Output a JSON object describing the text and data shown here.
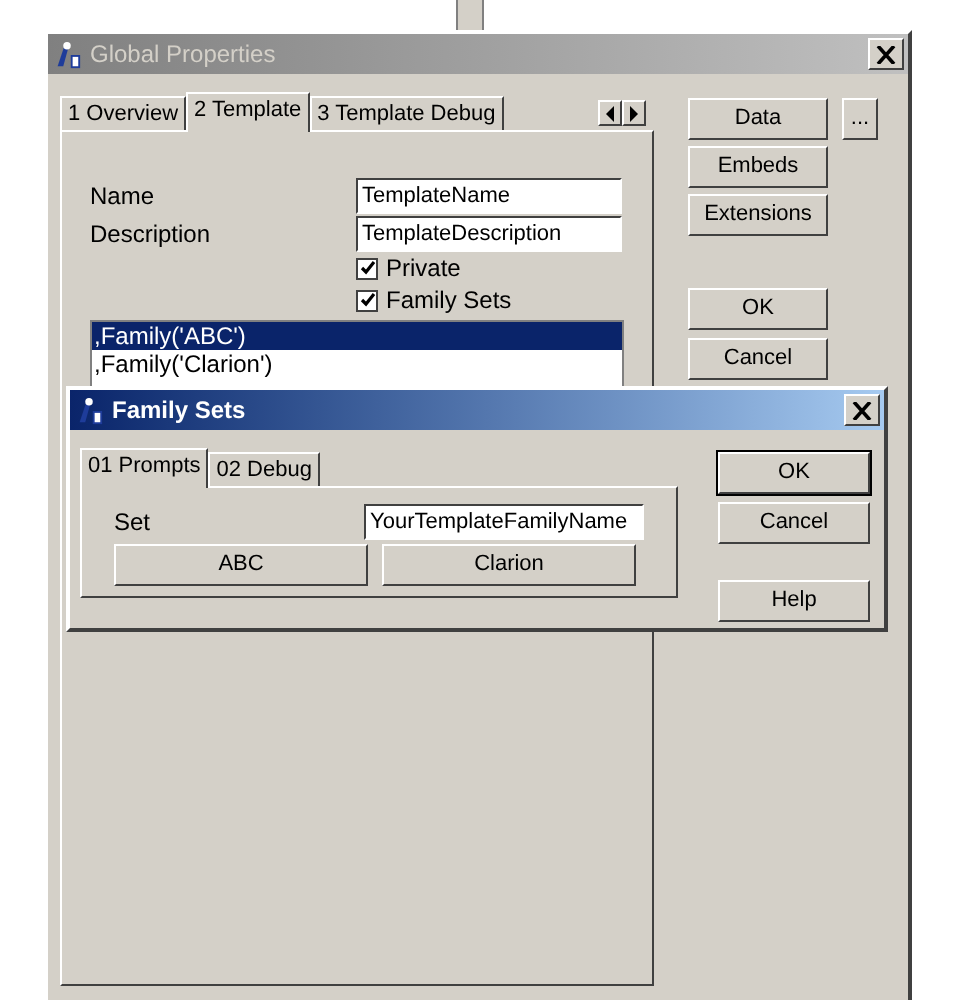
{
  "main_window": {
    "title": "Global Properties",
    "active": false,
    "tabs": [
      {
        "label": "1 Overview",
        "selected": false
      },
      {
        "label": "2 Template",
        "selected": true
      },
      {
        "label": "3 Template Debug",
        "selected": false
      }
    ],
    "fields": [
      {
        "label": "Name",
        "value": "TemplateName"
      },
      {
        "label": "Description",
        "value": "TemplateDescription"
      }
    ],
    "checkboxes": [
      {
        "label": "Private",
        "checked": true
      },
      {
        "label": "Family Sets",
        "checked": true
      }
    ],
    "family_list": [
      {
        "text": ",Family('ABC')",
        "selected": true
      },
      {
        "text": ",Family('Clarion')",
        "selected": false
      }
    ],
    "side_buttons": [
      {
        "label": "Data"
      },
      {
        "label": "Embeds"
      },
      {
        "label": "Extensions"
      }
    ],
    "more_button": "...",
    "dialog_buttons": [
      {
        "label": "OK"
      },
      {
        "label": "Cancel"
      }
    ]
  },
  "family_dialog": {
    "title": "Family Sets",
    "active": true,
    "tabs": [
      {
        "label": "01 Prompts",
        "selected": true
      },
      {
        "label": "02 Debug",
        "selected": false
      }
    ],
    "set_field": {
      "label": "Set",
      "value": "YourTemplateFamilyName"
    },
    "family_buttons": [
      {
        "label": "ABC"
      },
      {
        "label": "Clarion"
      }
    ],
    "buttons": [
      {
        "label": "OK",
        "default": true
      },
      {
        "label": "Cancel",
        "default": false
      },
      {
        "label": "Help",
        "default": false
      }
    ]
  }
}
